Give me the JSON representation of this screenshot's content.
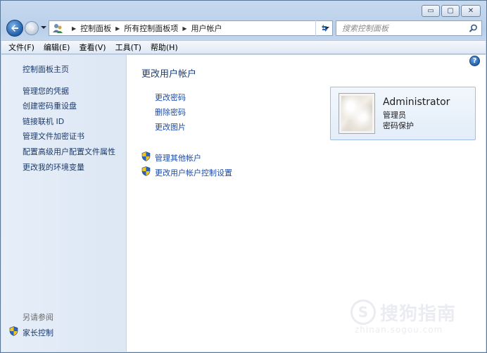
{
  "window": {
    "buttons": {
      "minimize": "▭",
      "maximize": "▢",
      "close": "✕"
    }
  },
  "nav": {
    "breadcrumbs": [
      "控制面板",
      "所有控制面板项",
      "用户帐户"
    ],
    "search_placeholder": "搜索控制面板"
  },
  "menubar": [
    "文件(F)",
    "编辑(E)",
    "查看(V)",
    "工具(T)",
    "帮助(H)"
  ],
  "sidebar": {
    "home": "控制面板主页",
    "links": [
      "管理您的凭据",
      "创建密码重设盘",
      "链接联机 ID",
      "管理文件加密证书",
      "配置高级用户配置文件属性",
      "更改我的环境变量"
    ],
    "see_also_heading": "另请参阅",
    "see_also_items": [
      "家长控制"
    ]
  },
  "main": {
    "title": "更改用户帐户",
    "tasks": [
      "更改密码",
      "删除密码",
      "更改图片"
    ],
    "admin_tasks": [
      "管理其他帐户",
      "更改用户帐户控制设置"
    ],
    "help_glyph": "?"
  },
  "account": {
    "name": "Administrator",
    "role": "管理员",
    "status": "密码保护"
  },
  "watermark": {
    "logo_glyph": "S",
    "text": "搜狗指南",
    "url": "zhinan.sogou.com"
  },
  "icons": {
    "back": "back-arrow-icon",
    "forward": "forward-arrow-icon",
    "refresh": "refresh-icon",
    "search": "search-icon",
    "shield": "uac-shield-icon",
    "users": "users-icon"
  },
  "colors": {
    "link": "#1a4aa8",
    "sidebar_link": "#1b3a6b",
    "title": "#1a3e72",
    "card_border": "#9fbfe4"
  }
}
